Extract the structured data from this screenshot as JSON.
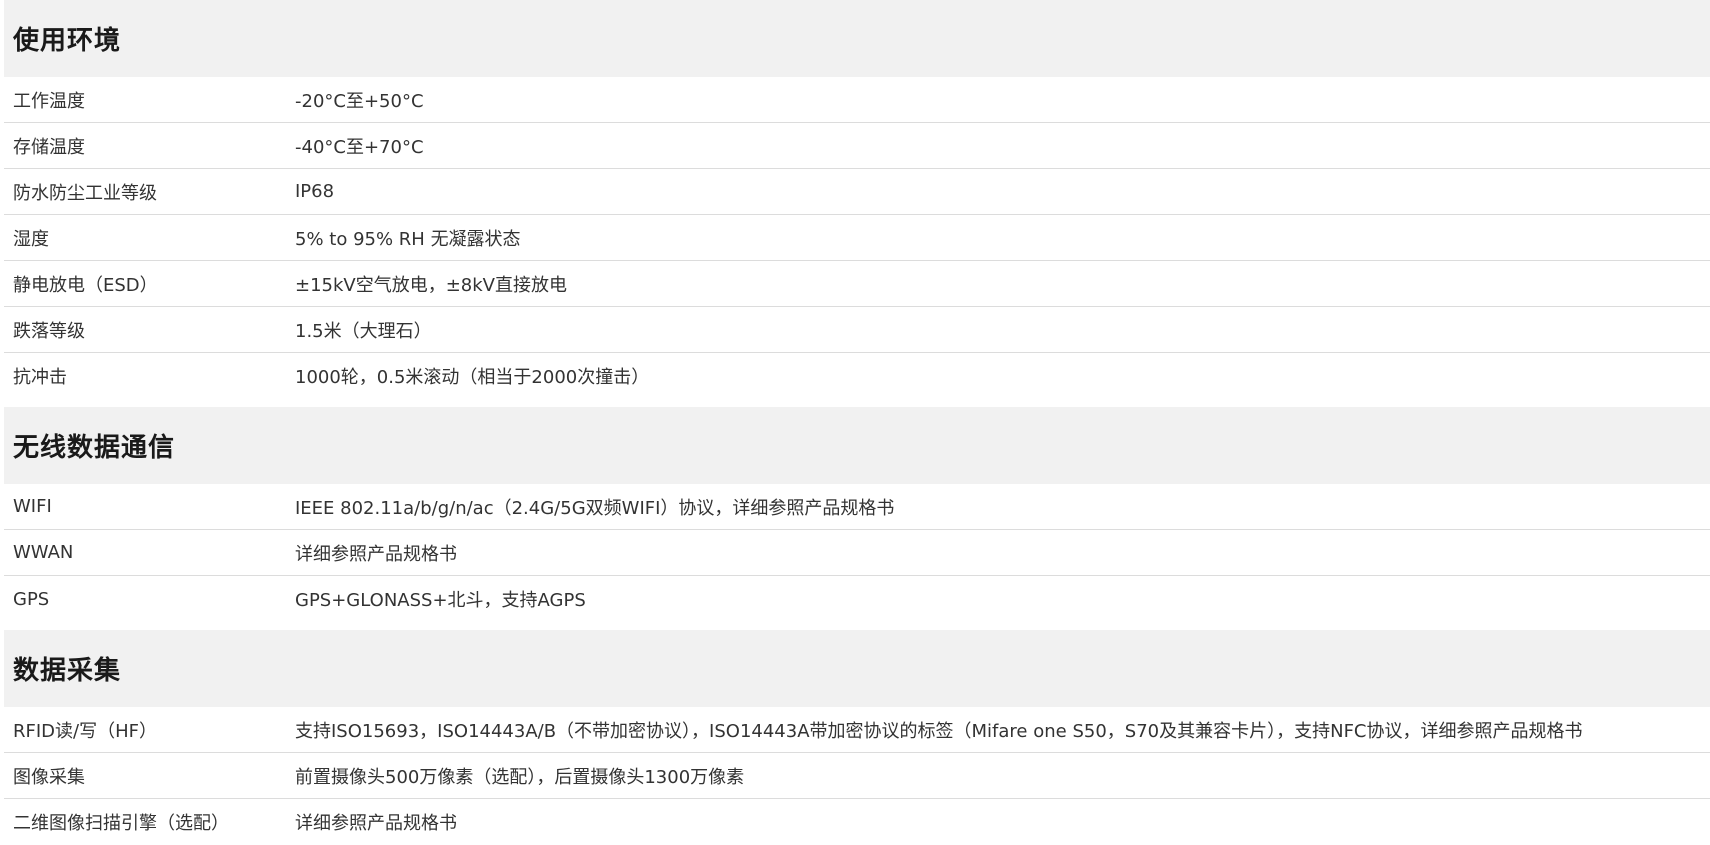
{
  "sections": [
    {
      "title": "使用环境",
      "rows": [
        {
          "label": "工作温度",
          "value": "-20°C至+50°C"
        },
        {
          "label": "存储温度",
          "value": "-40°C至+70°C"
        },
        {
          "label": "防水防尘工业等级",
          "value": "IP68"
        },
        {
          "label": "湿度",
          "value": "5% to 95% RH 无凝露状态"
        },
        {
          "label": "静电放电（ESD）",
          "value": "±15kV空气放电，±8kV直接放电"
        },
        {
          "label": "跌落等级",
          "value": "1.5米（大理石）"
        },
        {
          "label": "抗冲击",
          "value": "1000轮，0.5米滚动（相当于2000次撞击）"
        }
      ]
    },
    {
      "title": "无线数据通信",
      "rows": [
        {
          "label": "WIFI",
          "value": "IEEE 802.11a/b/g/n/ac（2.4G/5G双频WIFI）协议，详细参照产品规格书"
        },
        {
          "label": "WWAN",
          "value": "详细参照产品规格书"
        },
        {
          "label": "GPS",
          "value": "GPS+GLONASS+北斗，支持AGPS"
        }
      ]
    },
    {
      "title": "数据采集",
      "rows": [
        {
          "label": "RFID读/写（HF）",
          "value": "支持ISO15693，ISO14443A/B（不带加密协议），ISO14443A带加密协议的标签（Mifare one S50，S70及其兼容卡片），支持NFC协议，详细参照产品规格书"
        },
        {
          "label": "图像采集",
          "value": "前置摄像头500万像素（选配），后置摄像头1300万像素"
        },
        {
          "label": "二维图像扫描引擎（选配）",
          "value": "详细参照产品规格书"
        }
      ]
    }
  ]
}
